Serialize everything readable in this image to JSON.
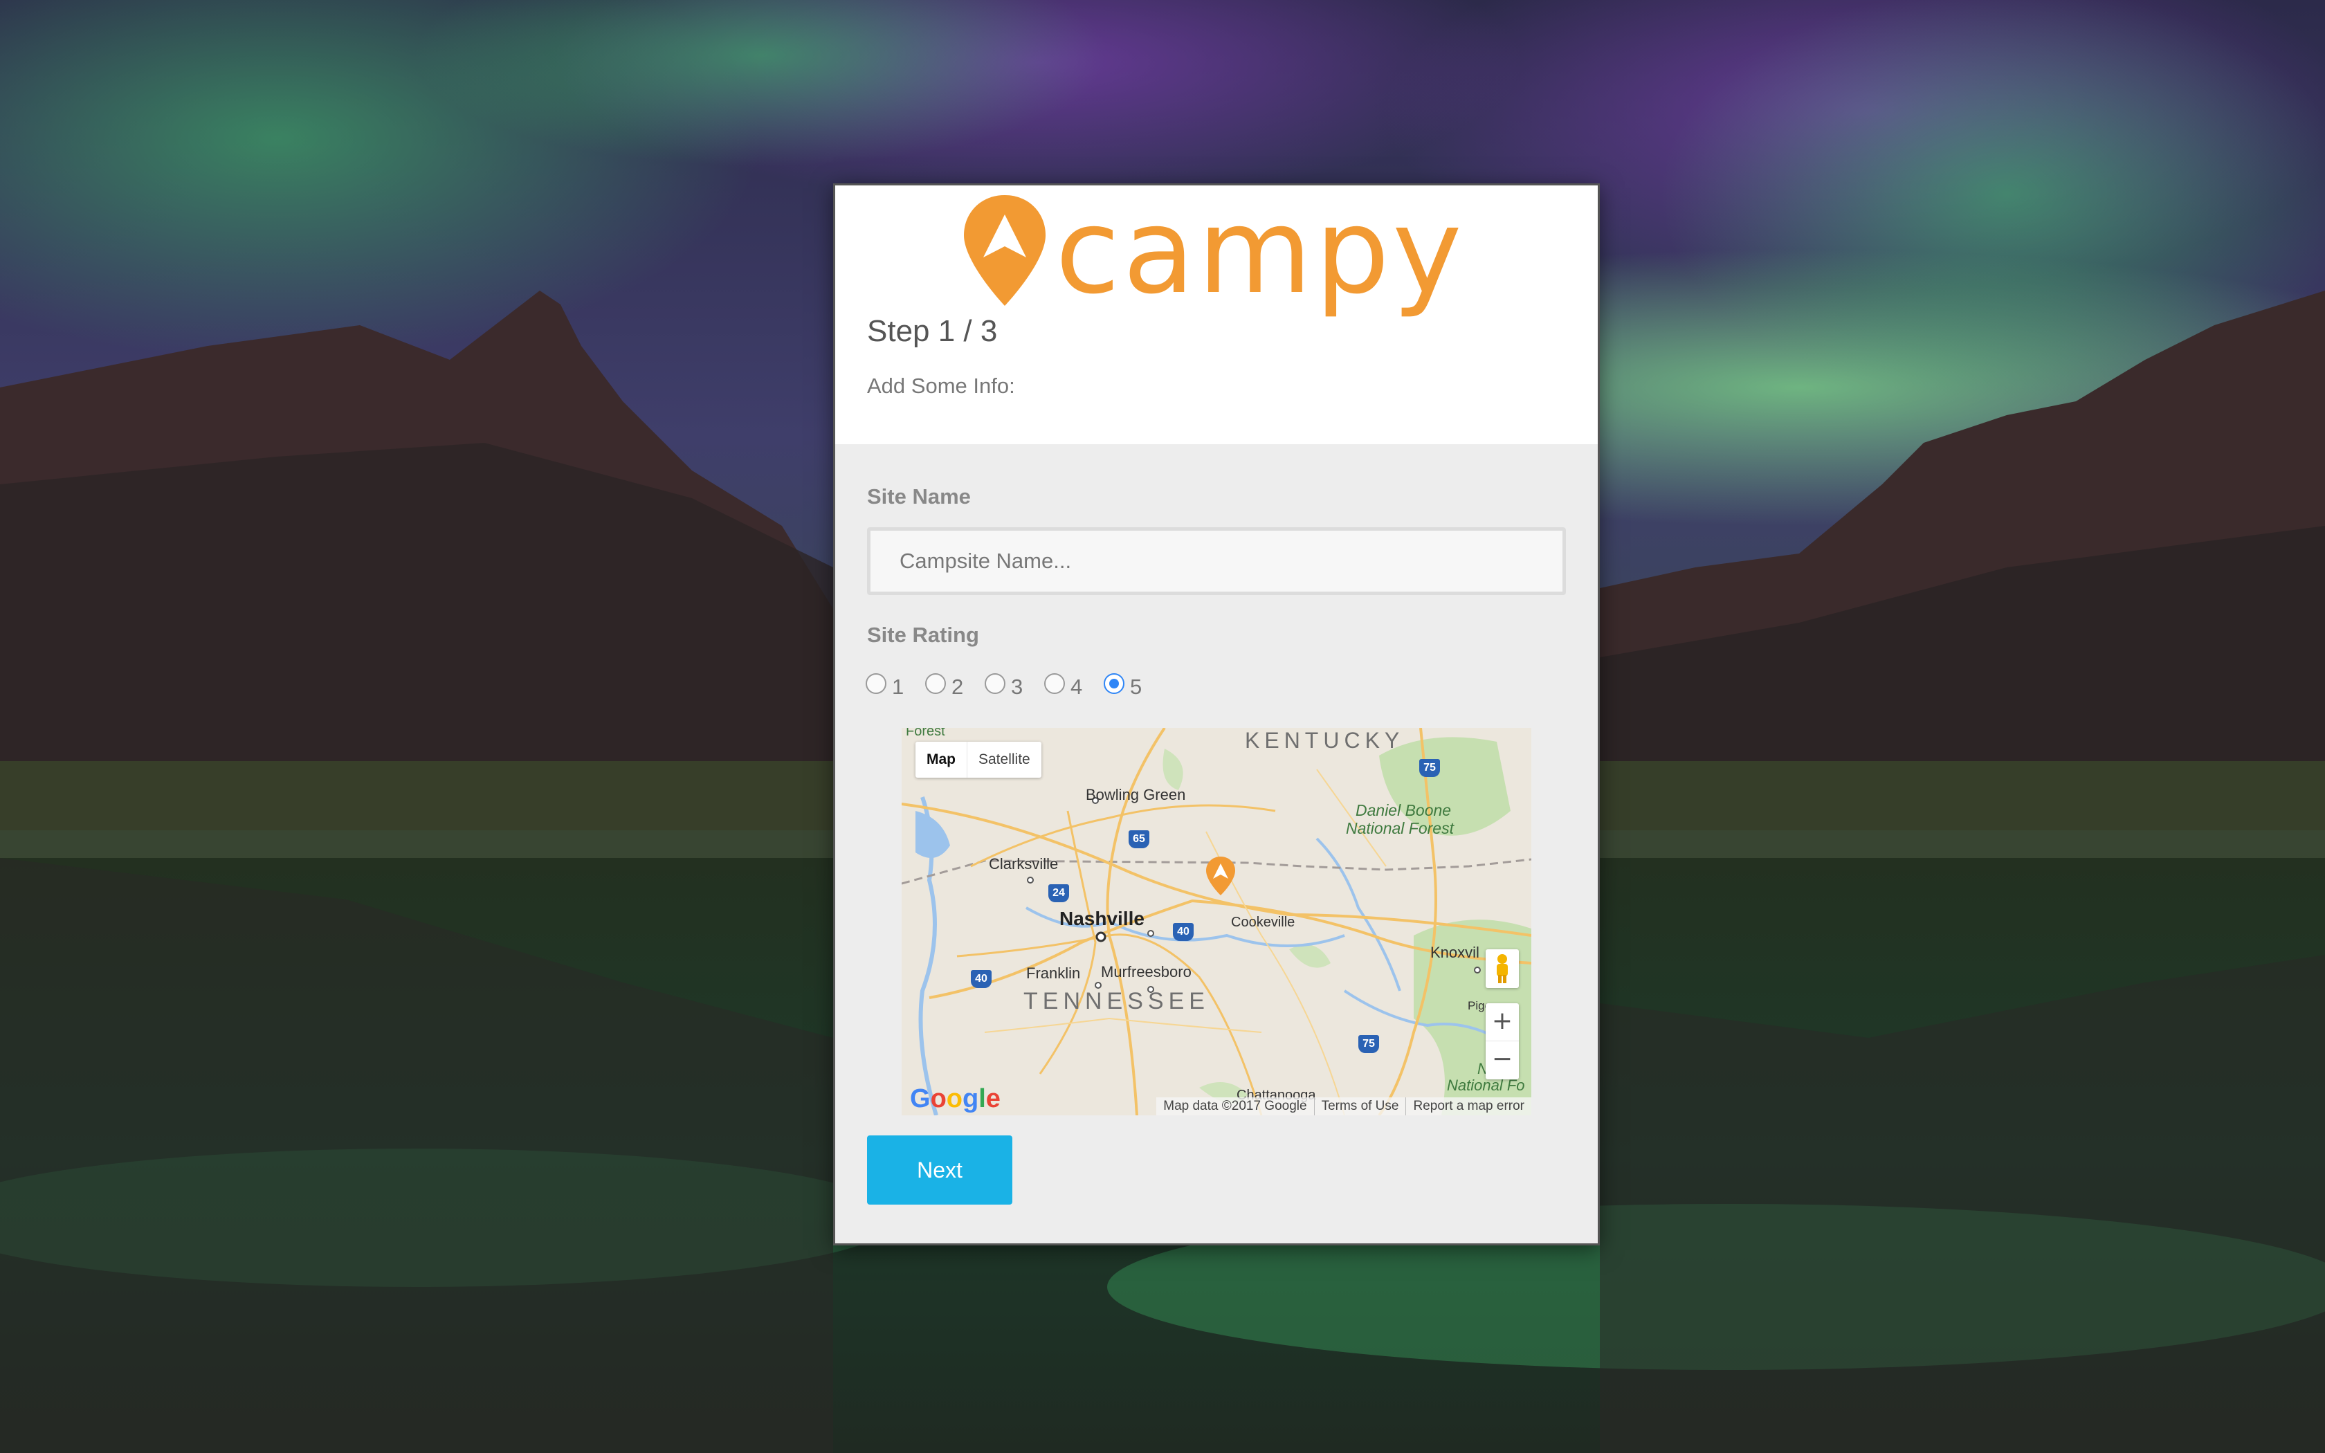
{
  "brand": {
    "name": "campy",
    "color": "#f29a33"
  },
  "wizard": {
    "step_title": "Step 1 / 3",
    "subtitle": "Add Some Info:"
  },
  "form": {
    "site_name": {
      "label": "Site Name",
      "value": "",
      "placeholder": "Campsite Name..."
    },
    "site_rating": {
      "label": "Site Rating",
      "options": [
        "1",
        "2",
        "3",
        "4",
        "5"
      ],
      "selected": "5"
    }
  },
  "map": {
    "type_controls": {
      "map": "Map",
      "satellite": "Satellite",
      "selected": "Map"
    },
    "labels": {
      "kentucky": "KENTUCKY",
      "tennessee": "TENNESSEE",
      "bowling_green": "Bowling Green",
      "clarksville": "Clarksville",
      "nashville": "Nashville",
      "cookeville": "Cookeville",
      "knoxville": "Knoxvil",
      "franklin": "Franklin",
      "murfreesboro": "Murfreesboro",
      "daniel_boone_1": "Daniel Boone",
      "daniel_boone_2": "National Forest",
      "forest_top": "Forest",
      "chattanooga": "Chattanooga",
      "pigeon": "Pigeo",
      "nf_right_1": "N",
      "nf_right_2": "National Fo"
    },
    "highway_shields": [
      "75",
      "65",
      "24",
      "40",
      "40",
      "75"
    ],
    "zoom_in": "+",
    "zoom_out": "−",
    "google": "Google",
    "footer": {
      "data": "Map data ©2017 Google",
      "terms": "Terms of Use",
      "report": "Report a map error"
    }
  },
  "actions": {
    "next": "Next"
  },
  "colors": {
    "accent": "#1ab2e6",
    "radio_checked": "#2f86f6",
    "panel_bg": "#ededed"
  }
}
